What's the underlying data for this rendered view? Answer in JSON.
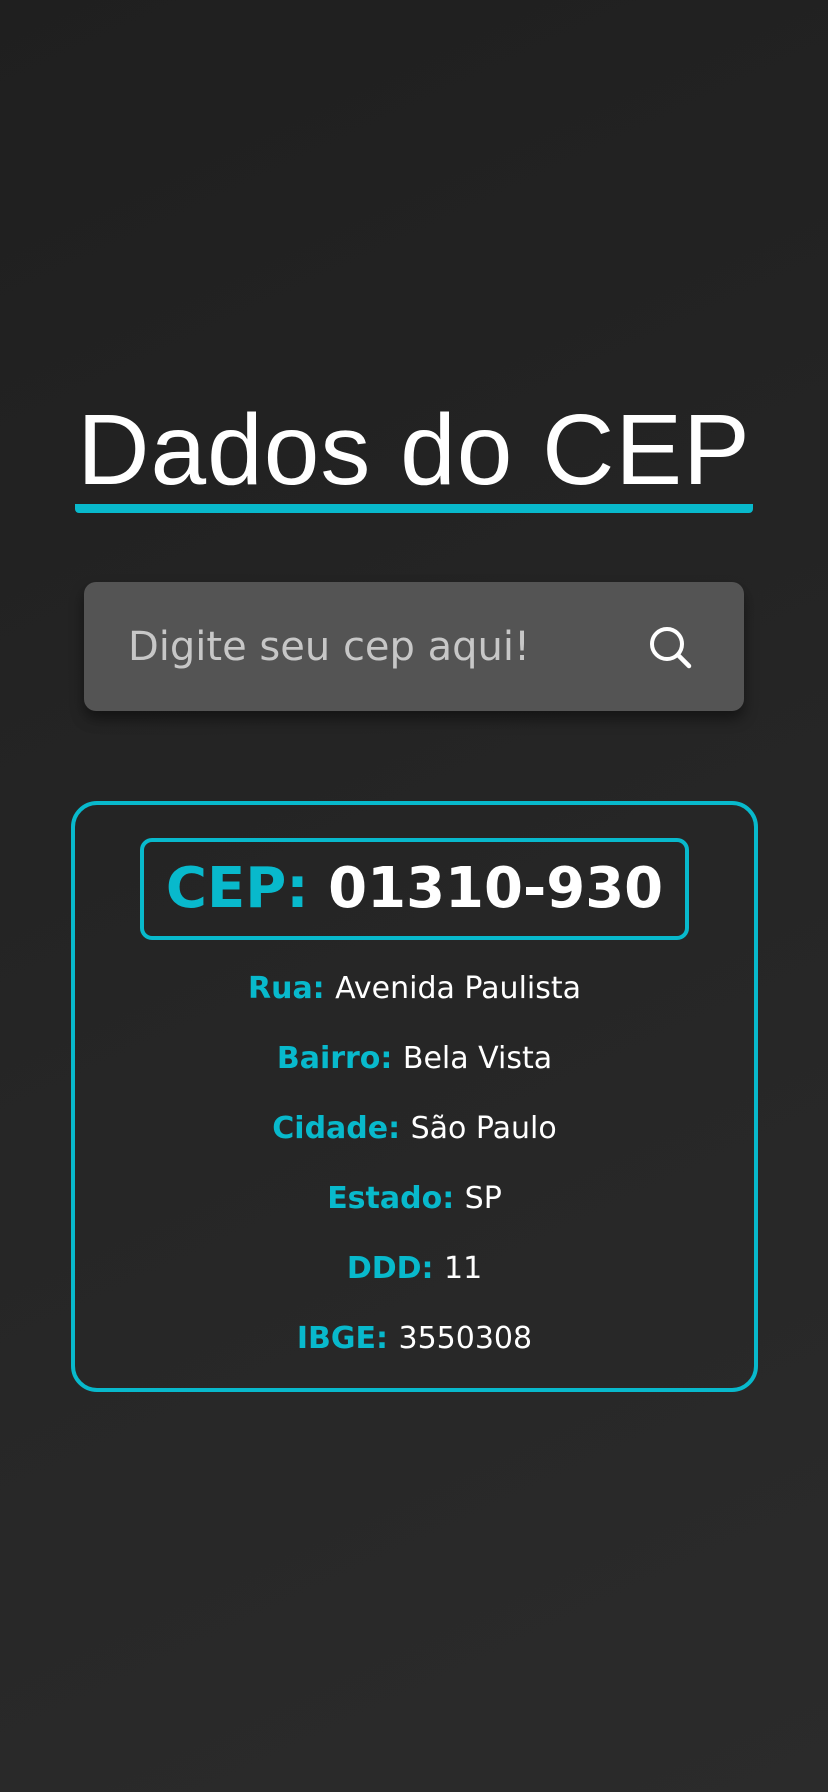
{
  "page": {
    "title": "Dados do CEP"
  },
  "search": {
    "placeholder": "Digite seu cep aqui!",
    "value": "",
    "icon": "search-icon"
  },
  "result": {
    "cep_label": "CEP:",
    "cep_value": "01310-930",
    "fields": [
      {
        "label": "Rua:",
        "value": "Avenida Paulista"
      },
      {
        "label": "Bairro:",
        "value": "Bela Vista"
      },
      {
        "label": "Cidade:",
        "value": "São Paulo"
      },
      {
        "label": "Estado:",
        "value": "SP"
      },
      {
        "label": "DDD:",
        "value": "11"
      },
      {
        "label": "IBGE:",
        "value": "3550308"
      }
    ]
  },
  "colors": {
    "accent": "#08b9cc",
    "background": "#242424",
    "input_background": "#545454",
    "text": "#ffffff"
  }
}
